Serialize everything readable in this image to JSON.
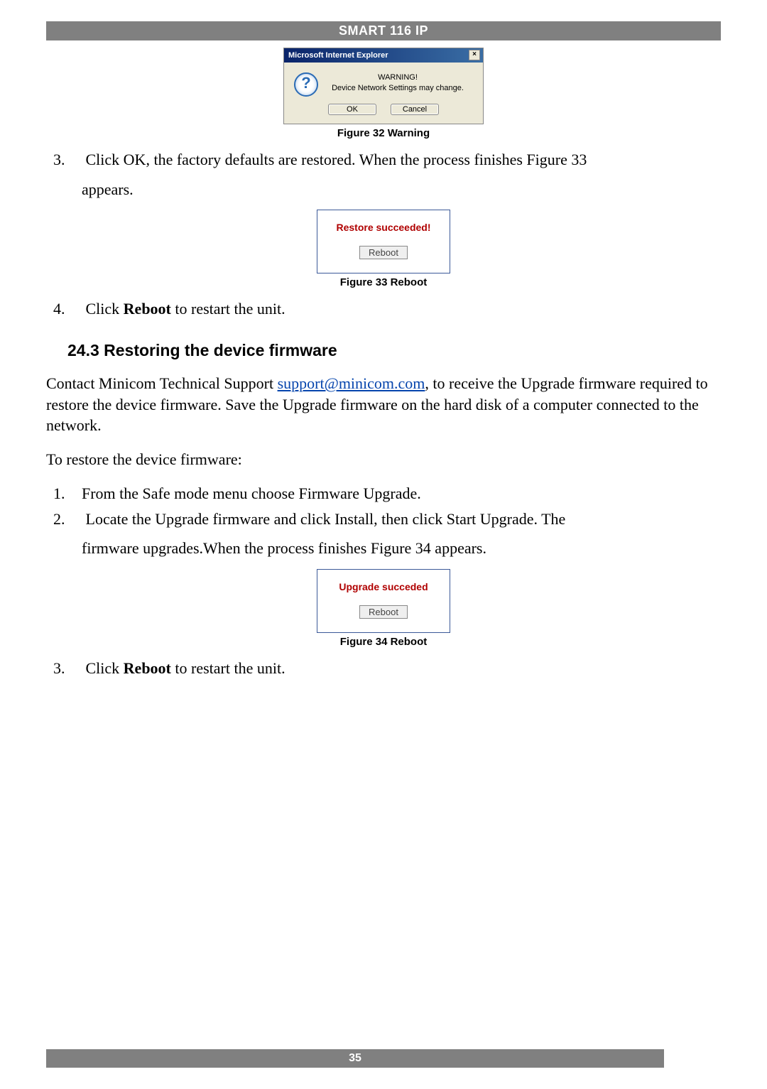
{
  "header": {
    "title": "SMART 116 IP"
  },
  "footer": {
    "page_number": "35"
  },
  "figure32": {
    "caption": "Figure 32 Warning",
    "titlebar": "Microsoft Internet Explorer",
    "close_glyph": "×",
    "icon_glyph": "?",
    "warning_line1": "WARNING!",
    "warning_line2": "Device Network Settings may change.",
    "ok_label": "OK",
    "cancel_label": "Cancel"
  },
  "step3": {
    "prefix": "Click ",
    "bold_word": "OK",
    "rest1": ", the factory defaults are restored. When the process finishes Figure 33",
    "rest2": "appears."
  },
  "figure33": {
    "caption": "Figure 33 Reboot",
    "msg": "Restore succeeded!",
    "button_label": "Reboot"
  },
  "step4": {
    "prefix": "Click ",
    "bold_word": "Reboot",
    "rest": " to restart the unit."
  },
  "section": {
    "heading": "24.3 Restoring the device firmware"
  },
  "para1": {
    "part1": "Contact Minicom Technical Support ",
    "email": "support@minicom.com",
    "part2": ", to receive the Upgrade firmware required to restore the device firmware. Save the Upgrade firmware on the hard disk of a computer connected to the network."
  },
  "para2": {
    "text": "To restore the device firmware:"
  },
  "steps_b": {
    "s1": "From the Safe mode menu choose Firmware Upgrade.",
    "s2a": "Locate the Upgrade firmware and click Install, then click Start Upgrade. The",
    "s2b": "firmware upgrades.When the process finishes Figure 34 appears."
  },
  "figure34": {
    "caption": "Figure 34 Reboot",
    "msg": "Upgrade succeded",
    "button_label": "Reboot"
  },
  "step_b3": {
    "prefix": "Click ",
    "bold_word": "Reboot",
    "rest": " to restart the unit."
  }
}
